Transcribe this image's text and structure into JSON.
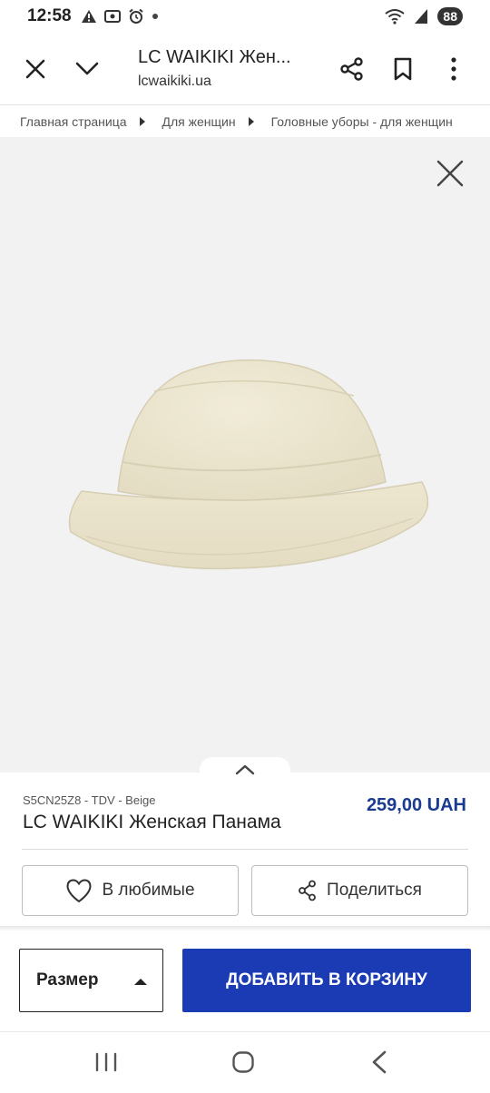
{
  "status_bar": {
    "time": "12:58",
    "battery": "88",
    "icons": [
      "warning-icon",
      "screen-record-icon",
      "alarm-icon",
      "dot-icon",
      "wifi-icon",
      "signal-icon"
    ]
  },
  "browser": {
    "title": "LC WAIKIKI Жен...",
    "url": "lcwaikiki.ua"
  },
  "breadcrumb": {
    "items": [
      "Главная страница",
      "Для женщин",
      "Головные уборы - для женщин"
    ]
  },
  "product": {
    "sku": "S5CN25Z8 - TDV - Beige",
    "name": "LC WAIKIKI Женская Панама",
    "price": "259,00 UAH",
    "favorite_label": "В любимые",
    "share_label": "Поделиться"
  },
  "purchase": {
    "size_label": "Размер",
    "add_to_cart_label": "ДОБАВИТЬ В КОРЗИНУ"
  },
  "colors": {
    "accent": "#1a3bb3",
    "price": "#1a3b8f"
  }
}
